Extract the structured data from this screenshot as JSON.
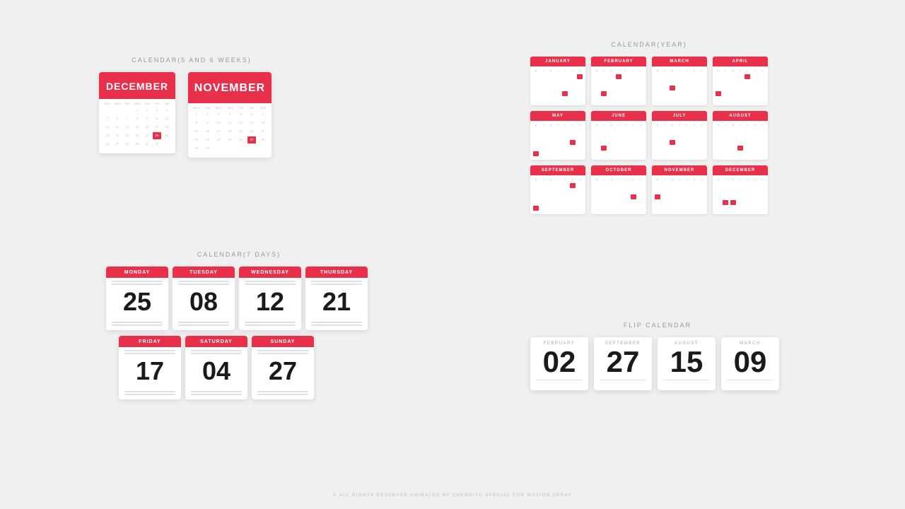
{
  "sections": {
    "weeks_label": "CALENDAR(5 AND 6 WEEKS)",
    "days_label": "CALENDAR(7 DAYS)",
    "year_label": "CALENDAR(YEAR)",
    "flip_label": "FLIP CALENDAR"
  },
  "december_cal": {
    "header": "DECEMBER",
    "days": [
      "SUN",
      "MON",
      "TUE",
      "WED",
      "THU",
      "FRI",
      "SAT"
    ],
    "rows": [
      [
        "",
        "",
        "",
        "1",
        "2",
        "3",
        "4"
      ],
      [
        "5",
        "6",
        "7",
        "8",
        "9",
        "10",
        "11"
      ],
      [
        "12",
        "13",
        "14",
        "15",
        "16",
        "17",
        "18"
      ],
      [
        "19",
        "20",
        "21",
        "22",
        "23",
        "24",
        "25"
      ],
      [
        "26",
        "27",
        "28",
        "29",
        "30",
        "31",
        ""
      ]
    ],
    "highlight": [
      3,
      4
    ]
  },
  "november_cal": {
    "header": "NOVEMBER",
    "days": [
      "MON",
      "TUE",
      "WED",
      "THU",
      "FRI",
      "SAT",
      "SUN"
    ],
    "rows": [
      [
        "1",
        "2",
        "3",
        "4",
        "5",
        "6",
        "7"
      ],
      [
        "8",
        "9",
        "10",
        "11",
        "12",
        "13",
        "14"
      ],
      [
        "15",
        "16",
        "17",
        "18",
        "19",
        "20",
        "21"
      ],
      [
        "22",
        "23",
        "24",
        "25",
        "26",
        "27",
        "28"
      ],
      [
        "29",
        "30",
        "",
        "",
        "",
        "",
        ""
      ]
    ],
    "highlight": [
      1,
      3
    ]
  },
  "day_calendars": [
    {
      "day": "MONDAY",
      "num": "25"
    },
    {
      "day": "TUESDAY",
      "num": "08"
    },
    {
      "day": "WEDNESDAY",
      "num": "12"
    },
    {
      "day": "THURSDAY",
      "num": "21"
    },
    {
      "day": "FRIDAY",
      "num": "17"
    },
    {
      "day": "SATURDAY",
      "num": "04"
    },
    {
      "day": "SUNDAY",
      "num": "27"
    }
  ],
  "year_months": [
    "JANUARY",
    "FEBRUARY",
    "MARCH",
    "APRIL",
    "MAY",
    "JUNE",
    "JULY",
    "AUGUST",
    "SEPTEMBER",
    "OCTOBER",
    "NOVEMBER",
    "DECEMBER"
  ],
  "flip_calendars": [
    {
      "month": "FEBRUARY",
      "num": "02"
    },
    {
      "month": "SEPTEMBER",
      "num": "27"
    },
    {
      "month": "AUGUST",
      "num": "15"
    },
    {
      "month": "MARCH",
      "num": "09"
    }
  ],
  "footer": "© ALL RIGHTS RESERVED ANIMATED BY CHERRITO SPECIAL FOR MOTION ARRAY",
  "colors": {
    "accent": "#e8304a",
    "bg": "#f0f0f0",
    "white": "#ffffff"
  }
}
